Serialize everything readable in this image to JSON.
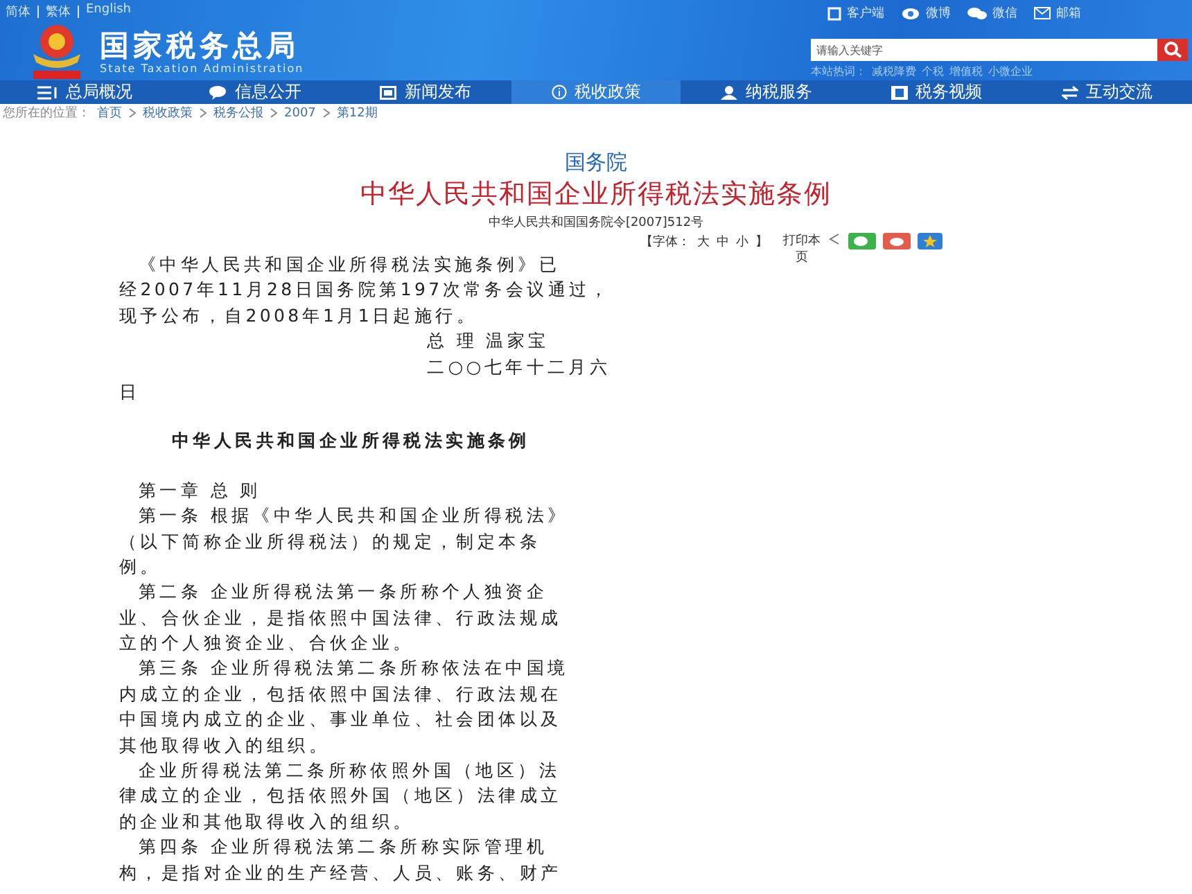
{
  "languages": [
    "简体",
    "繁体",
    "English"
  ],
  "site": {
    "title": "国家税务总局",
    "subtitle": "State Taxation Administration"
  },
  "top_links": [
    {
      "label": "客户端",
      "kind": "client"
    },
    {
      "label": "微博",
      "kind": "weibo"
    },
    {
      "label": "微信",
      "kind": "wechat"
    },
    {
      "label": "邮箱",
      "kind": "mail"
    }
  ],
  "search": {
    "placeholder": "请输入关键字"
  },
  "hot_words": {
    "label": "本站热词：",
    "words": [
      "减税降费",
      "个税",
      "增值税",
      "小微企业"
    ]
  },
  "nav": [
    {
      "label": "总局概况",
      "kind": "menu",
      "selected": false
    },
    {
      "label": "信息公开",
      "kind": "bubble",
      "selected": false
    },
    {
      "label": "新闻发布",
      "kind": "screen",
      "selected": false
    },
    {
      "label": "税收政策",
      "kind": "info",
      "selected": true
    },
    {
      "label": "纳税服务",
      "kind": "person",
      "selected": false
    },
    {
      "label": "税务视频",
      "kind": "video",
      "selected": false
    },
    {
      "label": "互动交流",
      "kind": "swap",
      "selected": false
    }
  ],
  "breadcrumb": {
    "label": "您所在的位置：",
    "items": [
      "首页",
      "税收政策",
      "税务公报",
      "2007",
      "第12期"
    ]
  },
  "article": {
    "issuer": "国务院",
    "title": "中华人民共和国企业所得税法实施条例",
    "doc_number": "中华人民共和国国务院令[2007]512号",
    "font_label": "【字体：",
    "font_sizes": [
      "大",
      "中",
      "小"
    ],
    "font_close": "】",
    "print": "打印本页",
    "lines": [
      {
        "text": "《中华人民共和国企业所得税法实施条例》已",
        "kind": "para"
      },
      {
        "text": "经2007年11月28日国务院第197次常务会议通过，",
        "kind": "line"
      },
      {
        "text": "现予公布，自2008年1月1日起施行。",
        "kind": "line"
      },
      {
        "text": "总 理  温家宝",
        "kind": "sign"
      },
      {
        "text": "二○○七年十二月六",
        "kind": "sign"
      },
      {
        "text": "日",
        "kind": "line"
      },
      {
        "kind": "gap"
      },
      {
        "text": "中华人民共和国企业所得税法实施条例",
        "kind": "heading"
      },
      {
        "kind": "gap"
      },
      {
        "text": "第一章 总  则",
        "kind": "para"
      },
      {
        "text": "第一条 根据《中华人民共和国企业所得税法》",
        "kind": "para"
      },
      {
        "text": "（以下简称企业所得税法）的规定，制定本条",
        "kind": "line"
      },
      {
        "text": "例。",
        "kind": "line"
      },
      {
        "text": "第二条 企业所得税法第一条所称个人独资企",
        "kind": "para"
      },
      {
        "text": "业、合伙企业，是指依照中国法律、行政法规成",
        "kind": "line"
      },
      {
        "text": "立的个人独资企业、合伙企业。",
        "kind": "line"
      },
      {
        "text": "第三条 企业所得税法第二条所称依法在中国境",
        "kind": "para"
      },
      {
        "text": "内成立的企业，包括依照中国法律、行政法规在",
        "kind": "line"
      },
      {
        "text": "中国境内成立的企业、事业单位、社会团体以及",
        "kind": "line"
      },
      {
        "text": "其他取得收入的组织。",
        "kind": "line"
      },
      {
        "text": "企业所得税法第二条所称依照外国（地区）法",
        "kind": "para"
      },
      {
        "text": "律成立的企业，包括依照外国（地区）法律成立",
        "kind": "line"
      },
      {
        "text": "的企业和其他取得收入的组织。",
        "kind": "line"
      },
      {
        "text": "第四条 企业所得税法第二条所称实际管理机",
        "kind": "para"
      },
      {
        "text": "构，是指对企业的生产经营、人员、账务、财产",
        "kind": "line"
      }
    ]
  }
}
